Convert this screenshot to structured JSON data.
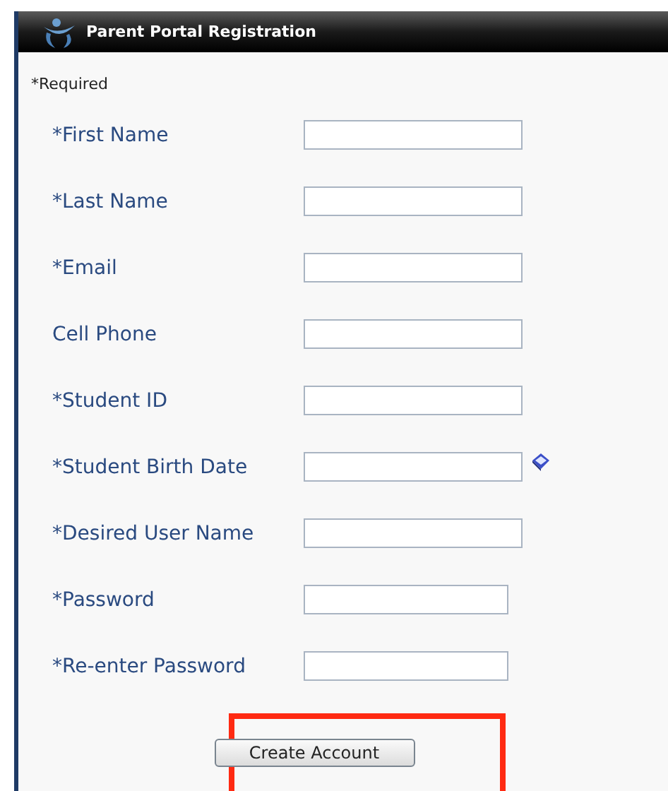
{
  "window": {
    "title": "Parent Portal Registration"
  },
  "required_note": "*Required",
  "fields": [
    {
      "label": "*First Name",
      "kind": "text"
    },
    {
      "label": "*Last Name",
      "kind": "text"
    },
    {
      "label": "*Email",
      "kind": "text"
    },
    {
      "label": "Cell Phone",
      "kind": "text"
    },
    {
      "label": "*Student ID",
      "kind": "text"
    },
    {
      "label": "*Student Birth Date",
      "kind": "date"
    },
    {
      "label": "*Desired User Name",
      "kind": "text"
    },
    {
      "label": "*Password",
      "kind": "password"
    },
    {
      "label": "*Re-enter Password",
      "kind": "password"
    }
  ],
  "submit_button": "Create Account"
}
